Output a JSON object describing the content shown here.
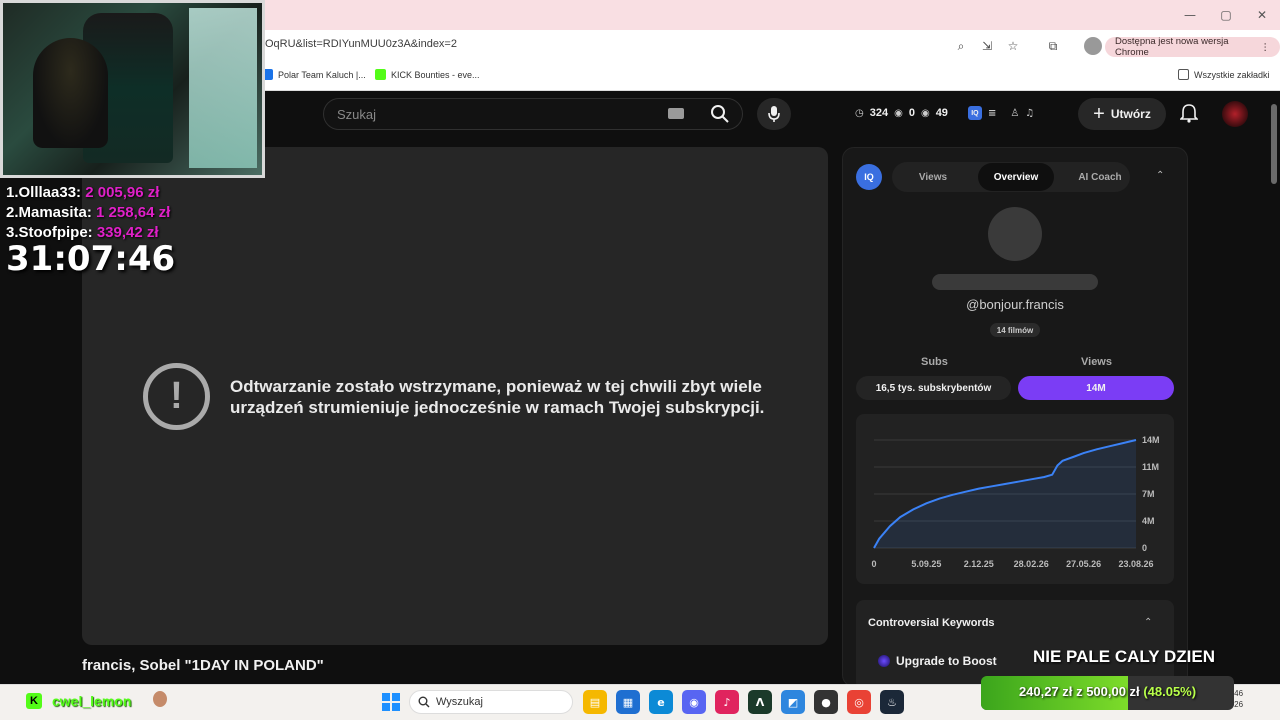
{
  "browser": {
    "url": "OqRU&list=RDIYunMUU0z3A&index=2",
    "update_notice": "Dostępna jest nowa wersja Chrome",
    "bookmarks": [
      {
        "label": "Polar Team Kaluch |...",
        "color": "#1a73e8"
      },
      {
        "label": "KICK Bounties - eve...",
        "color": "#53fc18"
      }
    ],
    "all_bookmarks": "Wszystkie zakładki",
    "window_controls": [
      "—",
      "▢",
      "✕"
    ]
  },
  "overlay": {
    "leaderboard": [
      {
        "name": "1.Olllaa33:",
        "amount": "2 005,96 zł"
      },
      {
        "name": "2.Mamasita:",
        "amount": "1 258,64 zł"
      },
      {
        "name": "3.Stoofpipe:",
        "amount": "339,42 zł"
      }
    ],
    "timer": "31:07:46",
    "banner": "NIE PALE CALY DZIEN",
    "goal": {
      "current": "240,27 zł",
      "separator": "z",
      "target": "500,00 zł",
      "percent_text": "(48.05%)",
      "fraction": 0.4805
    },
    "kick_user": "cwel_lemon"
  },
  "youtube": {
    "search_placeholder": "Szukaj",
    "stats": {
      "videos": "324",
      "watching": "0",
      "views": "49"
    },
    "create_label": "Utwórz",
    "player_error": "Odtwarzanie zostało wstrzymane, ponieważ w tej chwili zbyt wiele urządzeń strumieniuje jednocześnie w ramach Twojej subskrypcji.",
    "video_title": "francis, Sobel \"1DAY IN POLAND\""
  },
  "panel": {
    "logo": "IQ",
    "tabs": [
      "Views",
      "Overview",
      "AI Coach"
    ],
    "active_tab": "Overview",
    "channel_handle": "@bonjour.francis",
    "films": "14 filmów",
    "subs_label": "Subs",
    "views_label": "Views",
    "subs_value": "16,5 tys. subskrybentów",
    "views_value": "14M",
    "keywords_title": "Controversial Keywords",
    "boost_label": "Upgrade to Boost"
  },
  "chart_data": {
    "type": "line",
    "x_ticks": [
      "0",
      "5.09.25",
      "2.12.25",
      "28.02.26",
      "27.05.26",
      "23.08.26"
    ],
    "y_ticks": [
      "0",
      "4M",
      "7M",
      "11M",
      "14M"
    ],
    "ylim": [
      0,
      14
    ],
    "series": [
      {
        "color": "#3b82f6",
        "points": [
          [
            0,
            0
          ],
          [
            0.02,
            1.2
          ],
          [
            0.06,
            2.8
          ],
          [
            0.1,
            4.0
          ],
          [
            0.15,
            5.0
          ],
          [
            0.2,
            5.8
          ],
          [
            0.25,
            6.4
          ],
          [
            0.3,
            6.9
          ],
          [
            0.35,
            7.3
          ],
          [
            0.4,
            7.7
          ],
          [
            0.45,
            8.0
          ],
          [
            0.5,
            8.3
          ],
          [
            0.55,
            8.6
          ],
          [
            0.6,
            8.9
          ],
          [
            0.65,
            9.2
          ],
          [
            0.68,
            9.5
          ],
          [
            0.7,
            10.7
          ],
          [
            0.72,
            11.3
          ],
          [
            0.76,
            11.8
          ],
          [
            0.8,
            12.3
          ],
          [
            0.85,
            12.8
          ],
          [
            0.9,
            13.2
          ],
          [
            0.95,
            13.6
          ],
          [
            1.0,
            14.0
          ]
        ]
      }
    ]
  },
  "taskbar": {
    "search_placeholder": "Wyszukaj",
    "apps": [
      {
        "name": "file-explorer",
        "glyph": "▤",
        "color": "#f5b800"
      },
      {
        "name": "store",
        "glyph": "▦",
        "color": "#1f6fd1"
      },
      {
        "name": "edge",
        "glyph": "e",
        "color": "#0c8ad6"
      },
      {
        "name": "discord",
        "glyph": "◉",
        "color": "#5865f2"
      },
      {
        "name": "tiktok",
        "glyph": "♪",
        "color": "#e0245e"
      },
      {
        "name": "app-green",
        "glyph": "Λ",
        "color": "#1b3a2a"
      },
      {
        "name": "photos",
        "glyph": "◩",
        "color": "#2e86de"
      },
      {
        "name": "app-dark",
        "glyph": "●",
        "color": "#333"
      },
      {
        "name": "chrome",
        "glyph": "◎",
        "color": "#e94235"
      },
      {
        "name": "steam",
        "glyph": "♨",
        "color": "#1b2838"
      }
    ],
    "clock": "05:46",
    "date": "26.08.2026"
  }
}
